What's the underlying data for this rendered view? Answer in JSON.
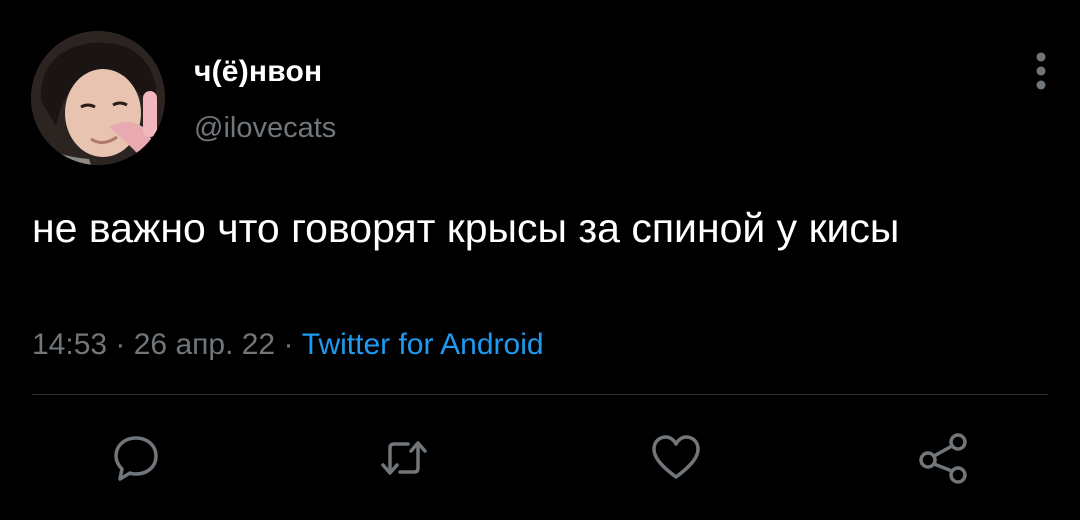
{
  "tweet": {
    "author": {
      "display_name": "ч(ё)нвон",
      "handle": "@ilovecats"
    },
    "text": "не важно что говорят крысы за спиной у кисы",
    "time": "14:53",
    "date": "26 апр. 22",
    "separator": " · ",
    "source": "Twitter for Android"
  },
  "actions": {
    "reply_icon": "reply-icon",
    "retweet_icon": "retweet-icon",
    "like_icon": "like-icon",
    "share_icon": "share-icon",
    "more_icon": "more-vertical-icon"
  },
  "colors": {
    "background": "#000000",
    "text": "#ffffff",
    "muted": "#71767b",
    "link": "#1d9bf0",
    "divider": "#2f3336"
  }
}
